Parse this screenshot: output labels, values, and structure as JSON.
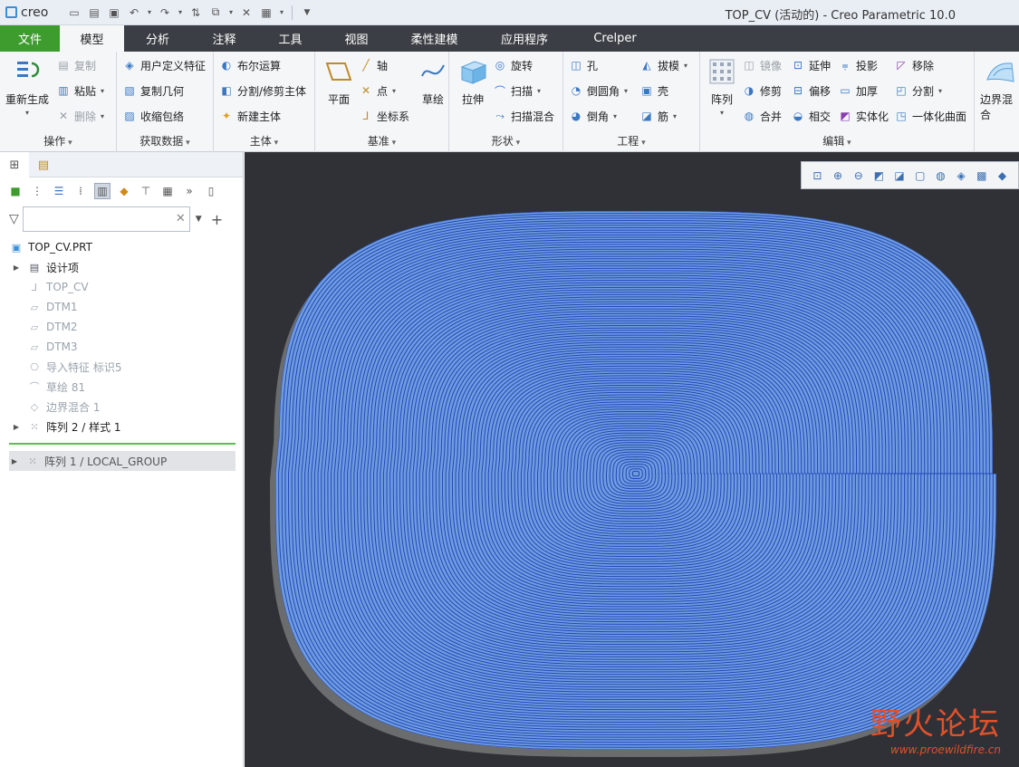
{
  "titlebar": {
    "app_name": "creo",
    "window_title": "TOP_CV (活动的) - Creo Parametric 10.0"
  },
  "tabs": [
    "文件",
    "模型",
    "分析",
    "注释",
    "工具",
    "视图",
    "柔性建模",
    "应用程序",
    "Crelper"
  ],
  "ribbon": {
    "groups": {
      "operations": {
        "label": "操作",
        "regenerate": "重新生成",
        "copy": "复制",
        "paste": "粘贴",
        "delete": "删除"
      },
      "get_data": {
        "label": "获取数据",
        "udf": "用户定义特征",
        "copy_geom": "复制几何",
        "shrinkwrap": "收缩包络"
      },
      "body": {
        "label": "主体",
        "boolean": "布尔运算",
        "split": "分割/修剪主体",
        "new_body": "新建主体"
      },
      "datum": {
        "label": "基准",
        "plane": "平面",
        "axis": "轴",
        "point": "点",
        "csys": "坐标系",
        "sketch": "草绘"
      },
      "shapes": {
        "label": "形状",
        "extrude": "拉伸",
        "revolve": "旋转",
        "sweep": "扫描",
        "swept_blend": "扫描混合"
      },
      "engineering": {
        "label": "工程",
        "hole": "孔",
        "round": "倒圆角",
        "chamfer": "倒角",
        "draft": "拔模",
        "shell": "壳",
        "rib": "筋"
      },
      "editing": {
        "label": "编辑",
        "pattern": "阵列",
        "mirror": "镜像",
        "trim": "修剪",
        "merge": "合并",
        "extend": "延伸",
        "offset": "偏移",
        "intersect": "相交",
        "project": "投影",
        "thicken": "加厚",
        "solidify": "实体化",
        "remove": "移除",
        "split": "分割",
        "unify": "一体化曲面"
      },
      "surfaces": {
        "boundary_blend": "边界混合"
      }
    }
  },
  "model_tree": {
    "filter_placeholder": "",
    "root": "TOP_CV.PRT",
    "items": [
      {
        "label": "设计项",
        "dim": false,
        "expandable": true,
        "icon": "design-items-icon"
      },
      {
        "label": "TOP_CV",
        "dim": true,
        "expandable": false,
        "icon": "csys-icon"
      },
      {
        "label": "DTM1",
        "dim": true,
        "expandable": false,
        "icon": "datum-plane-icon"
      },
      {
        "label": "DTM2",
        "dim": true,
        "expandable": false,
        "icon": "datum-plane-icon"
      },
      {
        "label": "DTM3",
        "dim": true,
        "expandable": false,
        "icon": "datum-plane-icon"
      },
      {
        "label": "导入特征 标识5",
        "dim": true,
        "expandable": false,
        "icon": "import-feature-icon"
      },
      {
        "label": "草绘 81",
        "dim": true,
        "expandable": false,
        "icon": "sketch-icon"
      },
      {
        "label": "边界混合 1",
        "dim": true,
        "expandable": false,
        "icon": "boundary-blend-icon"
      },
      {
        "label": "阵列 2 / 样式 1",
        "dim": false,
        "expandable": true,
        "icon": "pattern-icon"
      }
    ],
    "after_insert": {
      "label": "阵列 1 / LOCAL_GROUP",
      "icon": "pattern-icon"
    }
  },
  "watermark": {
    "chinese": "野火论坛",
    "url": "www.proewildfire.cn"
  },
  "colors": {
    "file_tab": "#3e9c2f",
    "viewport_bg": "#303136",
    "surface_fill": "#6f9be0",
    "contour_line": "#1f49b6",
    "insert_marker": "#58c04a"
  }
}
